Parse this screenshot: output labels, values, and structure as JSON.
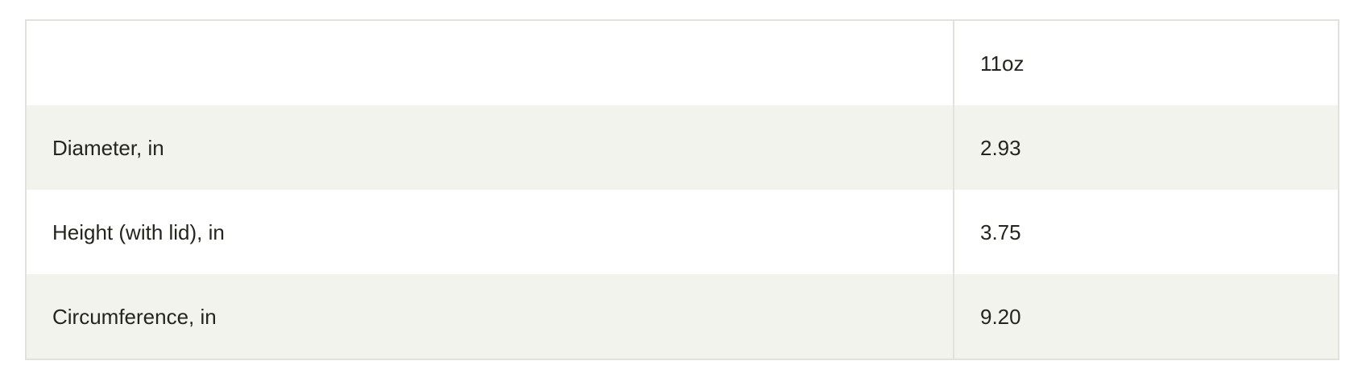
{
  "table": {
    "header": {
      "label": "",
      "value": "11oz"
    },
    "rows": [
      {
        "label": "Diameter, in",
        "value": "2.93"
      },
      {
        "label": "Height (with lid), in",
        "value": "3.75"
      },
      {
        "label": "Circumference, in",
        "value": "9.20"
      }
    ]
  }
}
